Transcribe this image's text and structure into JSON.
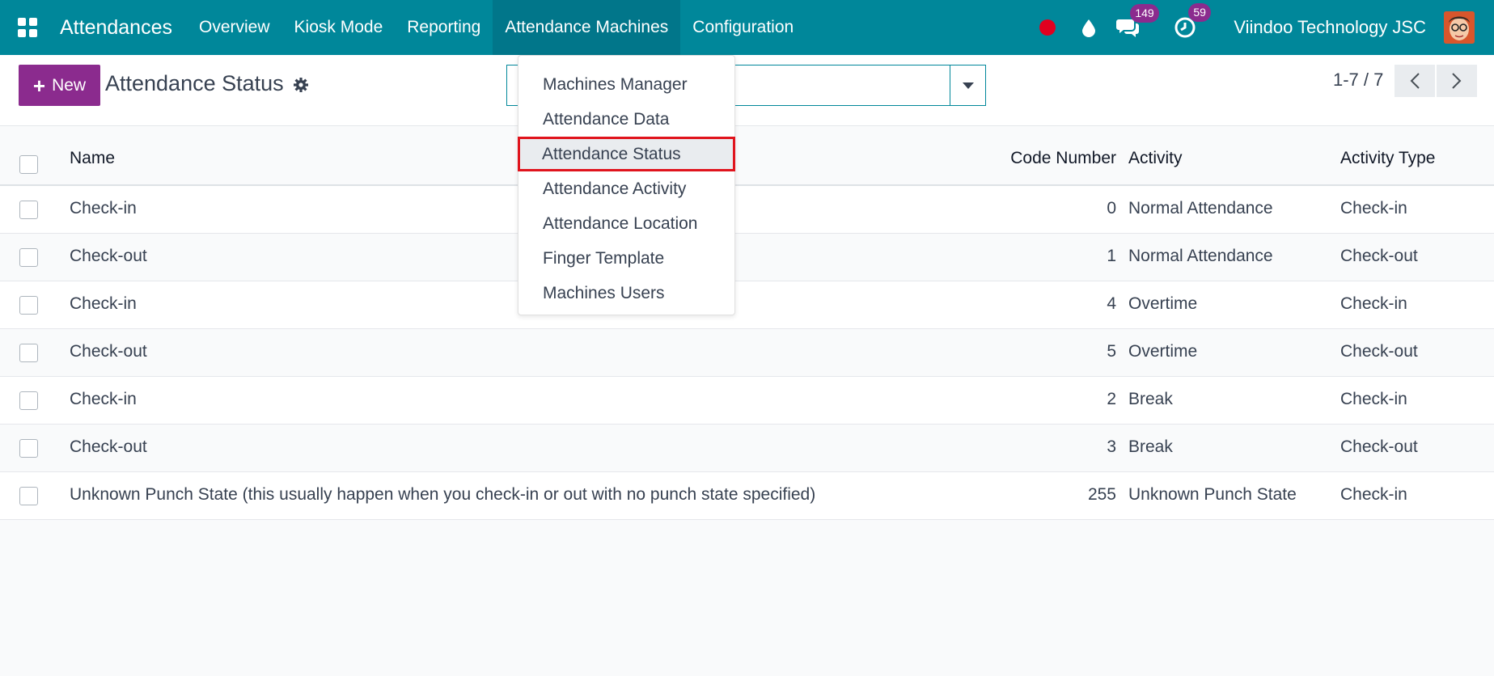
{
  "navbar": {
    "brand": "Attendances",
    "menu": [
      "Overview",
      "Kiosk Mode",
      "Reporting",
      "Attendance Machines",
      "Configuration"
    ],
    "messages_count": "149",
    "activities_count": "59",
    "company": "Viindoo Technology JSC",
    "accent": "#00879a"
  },
  "control": {
    "new_label": "New",
    "title": "Attendance Status",
    "search_placeholder": "",
    "pager": "1-7 / 7"
  },
  "dropdown": {
    "items": [
      "Machines Manager",
      "Attendance Data",
      "Attendance Status",
      "Attendance Activity",
      "Attendance Location",
      "Finger Template",
      "Machines Users"
    ],
    "selected": "Attendance Status"
  },
  "table": {
    "columns": [
      "Name",
      "Code Number",
      "Activity",
      "Activity Type"
    ],
    "rows": [
      {
        "name": "Check-in",
        "code": "0",
        "activity": "Normal Attendance",
        "type": "Check-in"
      },
      {
        "name": "Check-out",
        "code": "1",
        "activity": "Normal Attendance",
        "type": "Check-out"
      },
      {
        "name": "Check-in",
        "code": "4",
        "activity": "Overtime",
        "type": "Check-in"
      },
      {
        "name": "Check-out",
        "code": "5",
        "activity": "Overtime",
        "type": "Check-out"
      },
      {
        "name": "Check-in",
        "code": "2",
        "activity": "Break",
        "type": "Check-in"
      },
      {
        "name": "Check-out",
        "code": "3",
        "activity": "Break",
        "type": "Check-out"
      },
      {
        "name": "Unknown Punch State (this usually happen when you check-in or out with no punch state specified)",
        "code": "255",
        "activity": "Unknown Punch State",
        "type": "Check-in"
      }
    ]
  }
}
